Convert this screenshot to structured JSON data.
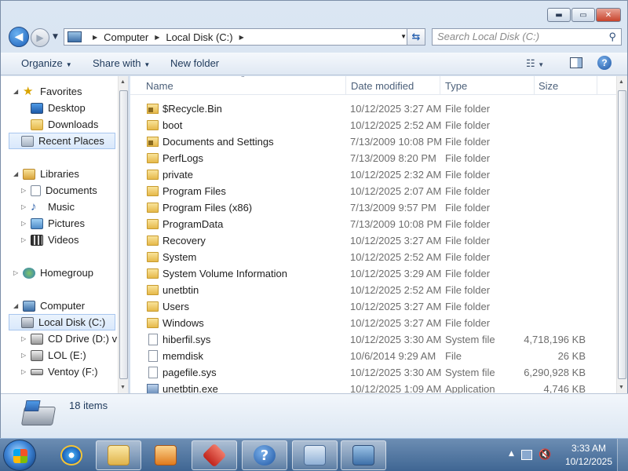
{
  "window": {
    "caption": {
      "minimize": "▬",
      "maximize": "▭",
      "close": "✕"
    }
  },
  "nav": {
    "address": [
      "Computer",
      "Local Disk (C:)"
    ],
    "search_placeholder": "Search Local Disk (C:)"
  },
  "toolbar": {
    "organize": "Organize",
    "share_with": "Share with",
    "new_folder": "New folder"
  },
  "sidebar": {
    "favorites": {
      "label": "Favorites",
      "items": [
        "Desktop",
        "Downloads",
        "Recent Places"
      ]
    },
    "libraries": {
      "label": "Libraries",
      "items": [
        "Documents",
        "Music",
        "Pictures",
        "Videos"
      ]
    },
    "homegroup": "Homegroup",
    "computer": {
      "label": "Computer",
      "items": [
        "Local Disk (C:)",
        "CD Drive (D:) virt",
        "LOL (E:)",
        "Ventoy (F:)"
      ]
    }
  },
  "columns": {
    "name": "Name",
    "date": "Date modified",
    "type": "Type",
    "size": "Size"
  },
  "files": [
    {
      "name": "$Recycle.Bin",
      "date": "10/12/2025 3:27 AM",
      "type": "File folder",
      "size": "",
      "icon": "locked"
    },
    {
      "name": "boot",
      "date": "10/12/2025 2:52 AM",
      "type": "File folder",
      "size": "",
      "icon": "folder"
    },
    {
      "name": "Documents and Settings",
      "date": "7/13/2009 10:08 PM",
      "type": "File folder",
      "size": "",
      "icon": "locked"
    },
    {
      "name": "PerfLogs",
      "date": "7/13/2009 8:20 PM",
      "type": "File folder",
      "size": "",
      "icon": "folder"
    },
    {
      "name": "private",
      "date": "10/12/2025 2:32 AM",
      "type": "File folder",
      "size": "",
      "icon": "folder"
    },
    {
      "name": "Program Files",
      "date": "10/12/2025 2:07 AM",
      "type": "File folder",
      "size": "",
      "icon": "folder"
    },
    {
      "name": "Program Files (x86)",
      "date": "7/13/2009 9:57 PM",
      "type": "File folder",
      "size": "",
      "icon": "folder"
    },
    {
      "name": "ProgramData",
      "date": "7/13/2009 10:08 PM",
      "type": "File folder",
      "size": "",
      "icon": "folder"
    },
    {
      "name": "Recovery",
      "date": "10/12/2025 3:27 AM",
      "type": "File folder",
      "size": "",
      "icon": "folder"
    },
    {
      "name": "System",
      "date": "10/12/2025 2:52 AM",
      "type": "File folder",
      "size": "",
      "icon": "folder"
    },
    {
      "name": "System Volume Information",
      "date": "10/12/2025 3:29 AM",
      "type": "File folder",
      "size": "",
      "icon": "folder"
    },
    {
      "name": "unetbtin",
      "date": "10/12/2025 2:52 AM",
      "type": "File folder",
      "size": "",
      "icon": "folder"
    },
    {
      "name": "Users",
      "date": "10/12/2025 3:27 AM",
      "type": "File folder",
      "size": "",
      "icon": "folder"
    },
    {
      "name": "Windows",
      "date": "10/12/2025 3:27 AM",
      "type": "File folder",
      "size": "",
      "icon": "folder"
    },
    {
      "name": "hiberfil.sys",
      "date": "10/12/2025 3:30 AM",
      "type": "System file",
      "size": "4,718,196 KB",
      "icon": "file"
    },
    {
      "name": "memdisk",
      "date": "10/6/2014 9:29 AM",
      "type": "File",
      "size": "26 KB",
      "icon": "file"
    },
    {
      "name": "pagefile.sys",
      "date": "10/12/2025 3:30 AM",
      "type": "System file",
      "size": "6,290,928 KB",
      "icon": "file"
    },
    {
      "name": "unetbtin.exe",
      "date": "10/12/2025 1:09 AM",
      "type": "Application",
      "size": "4,746 KB",
      "icon": "app"
    }
  ],
  "details": {
    "count": "18 items"
  },
  "taskbar": {
    "time": "3:33 AM",
    "date": "10/12/2025"
  }
}
